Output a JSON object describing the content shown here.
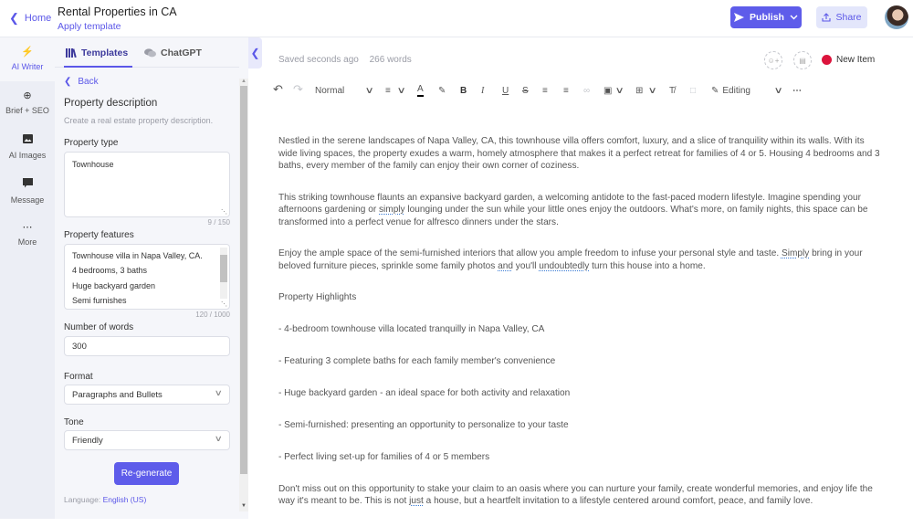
{
  "header": {
    "home_label": "Home",
    "doc_title": "Rental Properties in CA",
    "apply_template_label": "Apply template",
    "publish_label": "Publish",
    "share_label": "Share",
    "colors": {
      "accent": "#5e5cea",
      "share_bg": "#e3e6fb"
    }
  },
  "rail": {
    "items": [
      {
        "label": "AI Writer",
        "icon": "lightning-icon",
        "active": true
      },
      {
        "label": "Brief + SEO",
        "icon": "target-icon"
      },
      {
        "label": "AI Images",
        "icon": "image-icon"
      },
      {
        "label": "Message",
        "icon": "message-icon"
      },
      {
        "label": "More",
        "icon": "more-icon"
      }
    ]
  },
  "panel": {
    "tabs": [
      {
        "label": "Templates",
        "icon": "library-icon",
        "active": true
      },
      {
        "label": "ChatGPT",
        "icon": "chat-icon"
      }
    ],
    "back_label": "Back",
    "title": "Property description",
    "subtitle": "Create a real estate property description.",
    "property_type": {
      "label": "Property type",
      "value": "Townhouse",
      "counter": "9 / 150"
    },
    "property_features": {
      "label": "Property features",
      "lines": [
        "Townhouse villa in Napa Valley, CA.",
        "4 bedrooms, 3 baths",
        "Huge backyard garden",
        "Semi furnishes"
      ],
      "counter": "120 / 1000"
    },
    "number_of_words": {
      "label": "Number of words",
      "value": "300"
    },
    "format": {
      "label": "Format",
      "value": "Paragraphs and Bullets"
    },
    "tone": {
      "label": "Tone",
      "value": "Friendly"
    },
    "regenerate_label": "Re-generate",
    "language_label": "Language:",
    "language_value": "English (US)"
  },
  "editor": {
    "saved_status": "Saved seconds ago",
    "word_count": "266 words",
    "new_item_label": "New Item",
    "new_item_color": "#dc143c",
    "toolbar": {
      "style_value": "Normal",
      "mode_value": "Editing"
    },
    "paragraphs": {
      "p1": "Nestled in the serene landscapes of Napa Valley, CA, this townhouse villa offers comfort, luxury, and a slice of tranquility within its walls. With its wide living spaces, the property exudes a warm, homely atmosphere that makes it a perfect retreat for families of 4 or 5. Housing 4 bedrooms and 3 baths, every member of the family can enjoy their own corner of coziness.",
      "p2_a": "This striking townhouse flaunts an expansive backyard garden, a welcoming antidote to the fast-paced modern lifestyle. Imagine spending your afternoons gardening or ",
      "p2_spell": "simply",
      "p2_b": " lounging under the sun while your little ones enjoy the outdoors. What's more, on family nights, this space can be transformed into a perfect venue for alfresco dinners under the stars.",
      "p3_a": "Enjoy the ample space of the semi-furnished interiors that allow you ample freedom to infuse your personal style and taste. ",
      "p3_spell1": "Simply",
      "p3_b": " bring in your beloved furniture pieces, sprinkle some family photos ",
      "p3_spell2": "and",
      "p3_c": " you'll ",
      "p3_spell3": "undoubtedly",
      "p3_d": " turn this house into a home.",
      "highlights_heading": "Property Highlights",
      "bullets": [
        "- 4-bedroom townhouse villa located tranquilly in Napa Valley, CA",
        "- Featuring 3 complete baths for each family member's convenience",
        "- Huge backyard garden - an ideal space for both activity and relaxation",
        "- Semi-furnished: presenting an opportunity to personalize to your taste",
        "- Perfect living set-up for families of 4 or 5 members"
      ],
      "p_last_a": "Don't miss out on this opportunity to stake your claim to an oasis where you can nurture your family, create wonderful memories, and enjoy life the way it's meant to be. This is not ",
      "p_last_spell": "just",
      "p_last_b": " a house, but a heartfelt invitation to a lifestyle centered around comfort, peace, and family love."
    }
  }
}
